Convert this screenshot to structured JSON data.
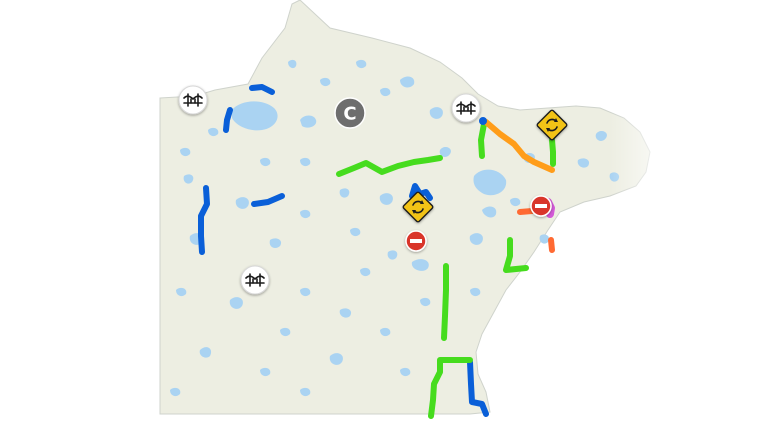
{
  "map": {
    "region_fill": "#edeee2",
    "border_color": "#cfd3cc",
    "water_color": "#aad3f2",
    "background": "#ffffff"
  },
  "legend_colors": {
    "blue": "#0a5fd8",
    "green": "#46dc1e",
    "orange": "#ff9d1a",
    "red_orange": "#ff6a33",
    "magenta": "#d35ad8"
  },
  "markers": [
    {
      "id": "bridge-nw",
      "icon": "bridge-icon",
      "kind": "bridge"
    },
    {
      "id": "bridge-ne",
      "icon": "bridge-icon",
      "kind": "bridge"
    },
    {
      "id": "bridge-sw",
      "icon": "bridge-icon",
      "kind": "bridge"
    },
    {
      "id": "category-c",
      "icon": "category-c-icon",
      "kind": "category",
      "label": "C"
    },
    {
      "id": "detour-ne",
      "icon": "roundabout-sign-icon",
      "kind": "detour"
    },
    {
      "id": "detour-center",
      "icon": "roundabout-sign-icon",
      "kind": "detour"
    },
    {
      "id": "closure-center",
      "icon": "road-closed-icon",
      "kind": "closure"
    },
    {
      "id": "closure-east",
      "icon": "road-closed-icon",
      "kind": "closure"
    }
  ]
}
